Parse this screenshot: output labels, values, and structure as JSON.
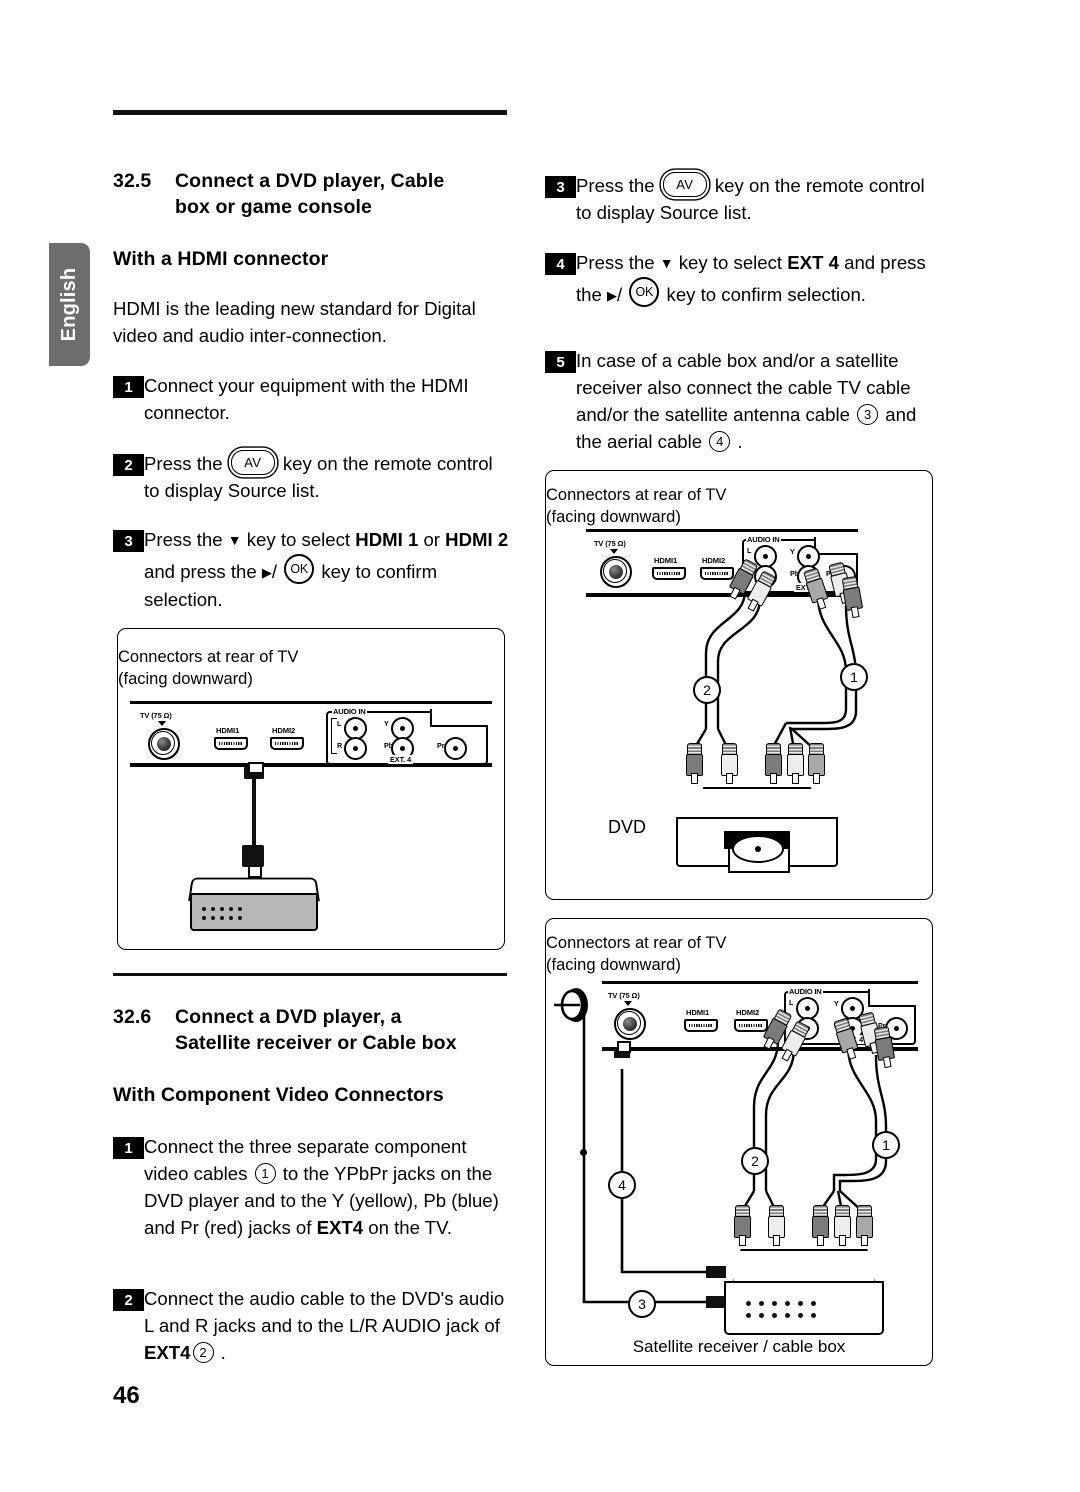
{
  "page": {
    "number": "46",
    "language_tab": "English"
  },
  "sections": {
    "s325": {
      "number": "32.5",
      "title_line1": "Connect a DVD player, Cable",
      "title_line2": "box or game console",
      "subheading": "With a HDMI connector",
      "intro": "HDMI is the leading new standard for Digital video and audio inter-connection.",
      "steps": [
        {
          "num": "1",
          "text": "Connect your equipment with the HDMI connector."
        },
        {
          "num": "2",
          "text_before": "Press the ",
          "key": "AV",
          "text_after": " key on the remote control to display Source list."
        },
        {
          "num": "3",
          "t1": "Press the ",
          "arrow_down": "▼",
          "t2": " key to select ",
          "b1": "HDMI 1",
          "t3": " or ",
          "b2": "HDMI 2",
          "t4": " and press the ",
          "arrow_right": "▶",
          "t5": "/ ",
          "key": "OK",
          "t6": " key to confirm selection."
        }
      ]
    },
    "s326": {
      "number": "32.6",
      "title_line1": "Connect a DVD player, a",
      "title_line2": "Satellite receiver or Cable box",
      "subheading": "With Component Video Connectors",
      "steps": [
        {
          "num": "1",
          "t1": "Connect the three separate component video cables ",
          "circ": "1",
          "t2": " to the YPbPr jacks on the DVD player and to the Y (yellow), Pb (blue) and Pr (red) jacks of ",
          "b1": "EXT4",
          "t3": " on the TV."
        },
        {
          "num": "2",
          "t1": "Connect the audio cable to the DVD's audio L and R jacks and to the L/R AUDIO jack of ",
          "b1": "EXT4",
          "circ": "2",
          "t2": " ."
        }
      ]
    },
    "right_steps": [
      {
        "num": "3",
        "text_before": "Press the ",
        "key": "AV",
        "text_after": " key on the remote control to display Source list."
      },
      {
        "num": "4",
        "t1": "Press the ",
        "arrow_down": "▼",
        "t2": " key to select ",
        "b1": "EXT 4",
        "t3": " and press the ",
        "arrow_right": "▶",
        "t4": "/ ",
        "key": "OK",
        "t5": " key to confirm selection."
      },
      {
        "num": "5",
        "t1": "In case of a cable box and/or a satellite receiver also connect the cable TV cable and/or the satellite antenna cable ",
        "circ1": "3",
        "t2": " and the aerial cable ",
        "circ2": "4",
        "t3": " ."
      }
    ]
  },
  "diagrams": {
    "caption_line1": "Connectors at rear of TV",
    "caption_line2": "(facing downward)",
    "panel_labels": {
      "tv_coax": "TV (75 Ω)",
      "hdmi1": "HDMI1",
      "hdmi2": "HDMI2",
      "audio_in": "AUDIO IN",
      "left": "L",
      "right": "R",
      "y": "Y",
      "pb": "Pb",
      "pr": "Pr",
      "ext4": "EXT. 4"
    },
    "hdmi_diagram": {
      "device_label": ""
    },
    "dvd_diagram": {
      "device_label": "DVD",
      "cable_markers": [
        "1",
        "2"
      ]
    },
    "satellite_diagram": {
      "device_label": "Satellite receiver / cable box",
      "cable_markers": [
        "1",
        "2",
        "3",
        "4"
      ]
    }
  }
}
